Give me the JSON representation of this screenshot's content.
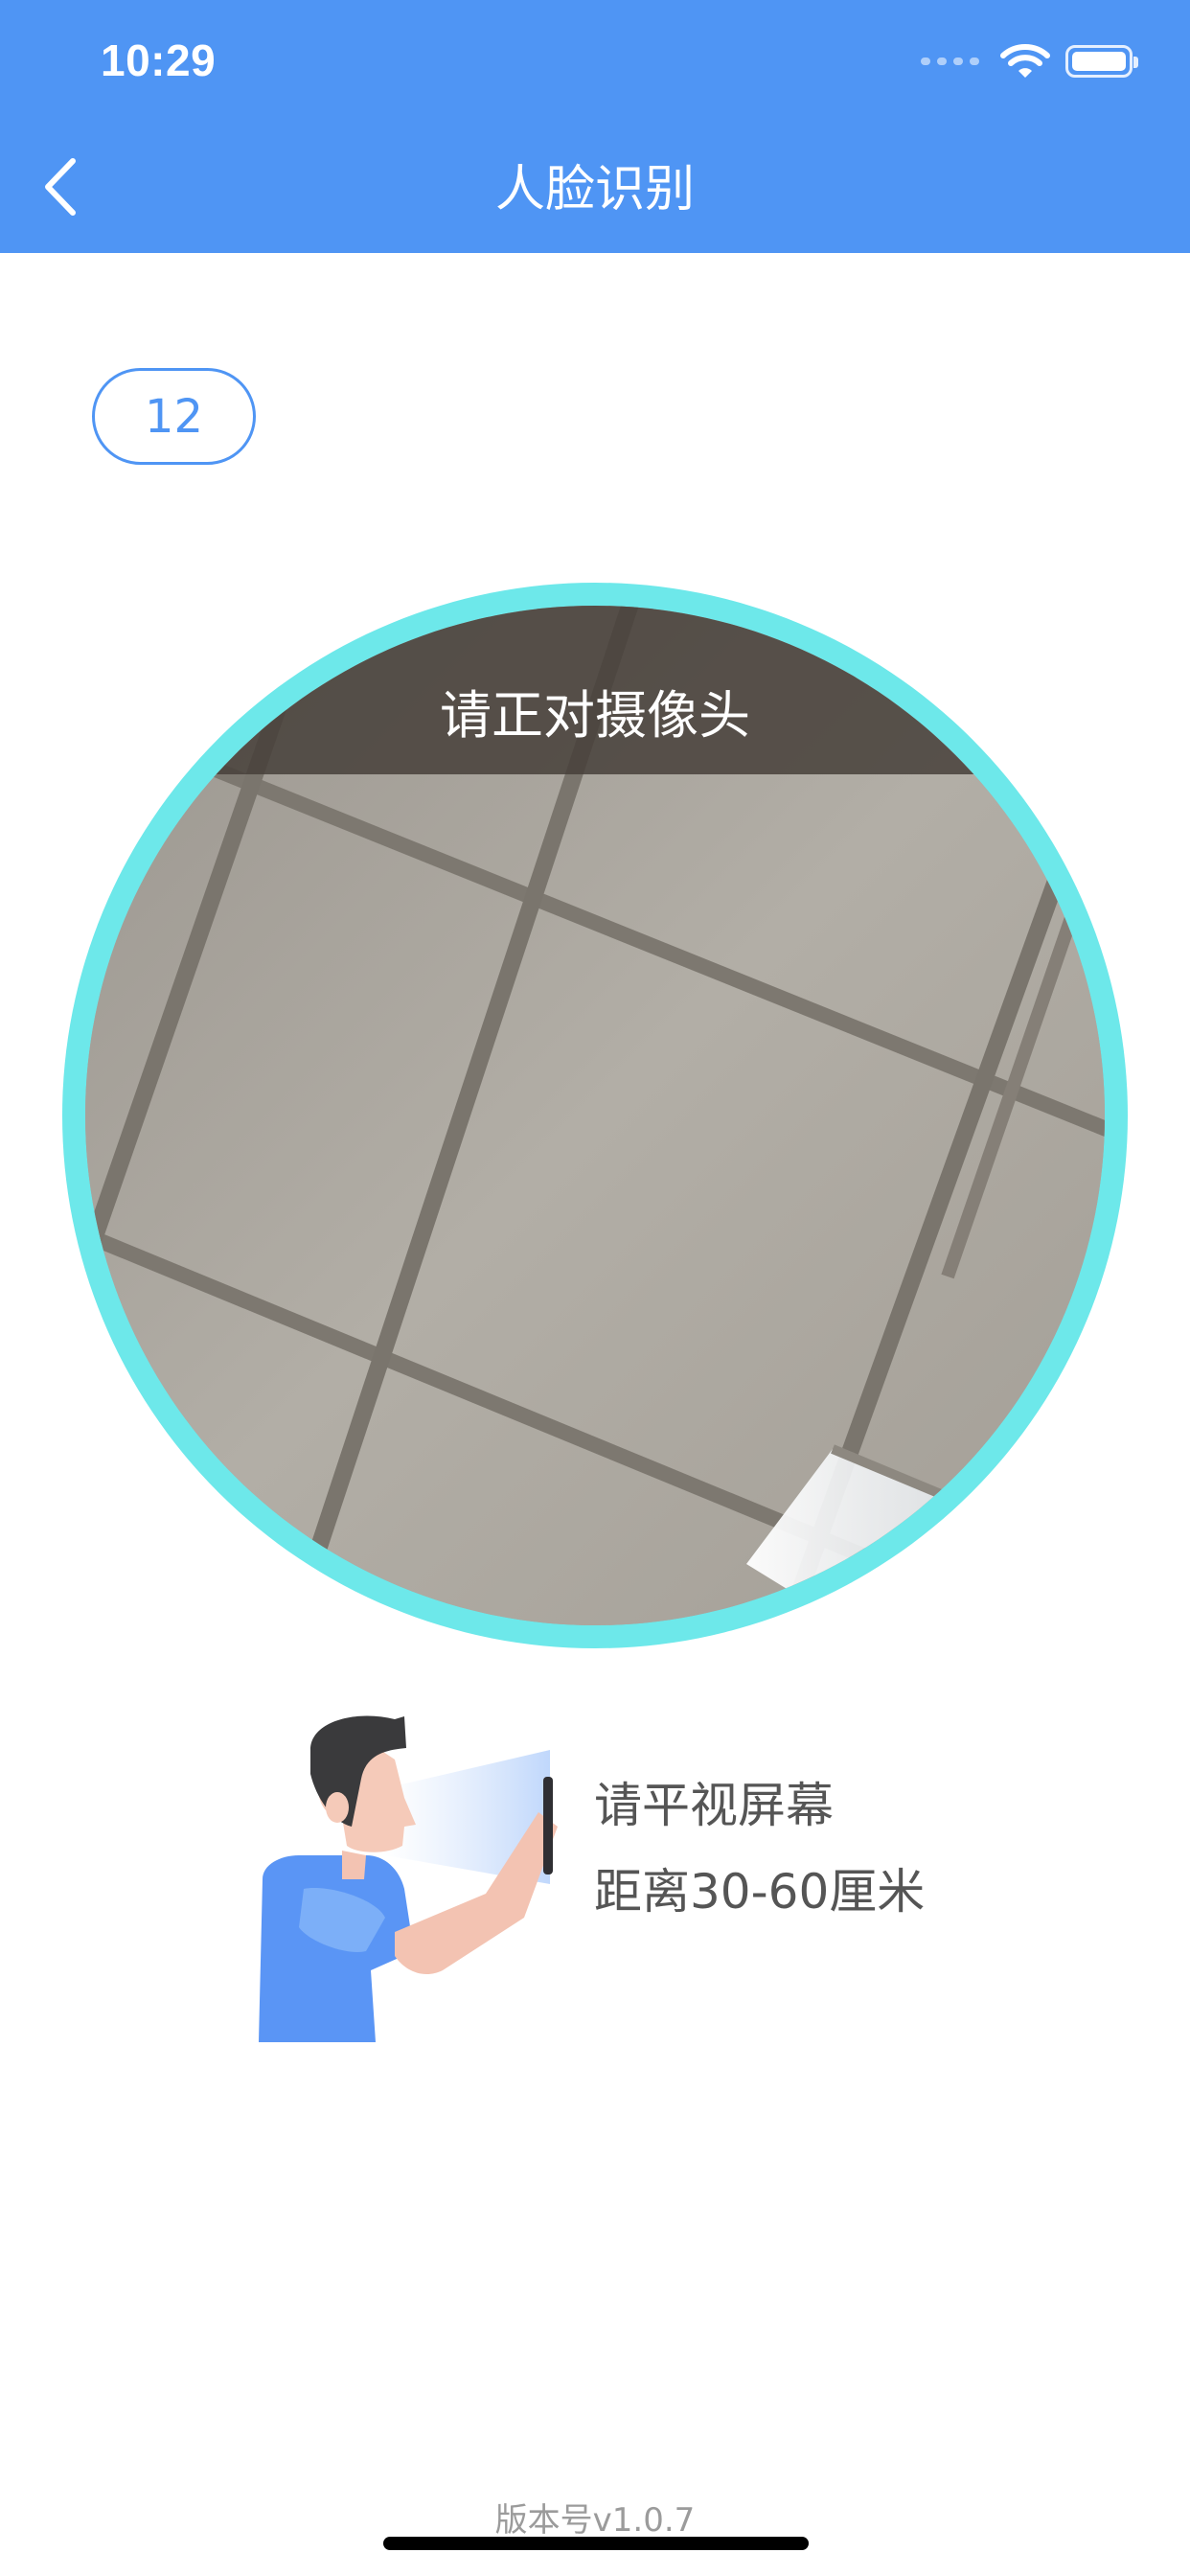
{
  "status_bar": {
    "time": "10:29"
  },
  "nav": {
    "title": "人脸识别"
  },
  "countdown": {
    "value": "12"
  },
  "camera": {
    "hint": "请正对摄像头"
  },
  "tips": {
    "line1": "请平视屏幕",
    "line2": "距离30-60厘米"
  },
  "footer": {
    "version": "版本号v1.0.7"
  },
  "colors": {
    "header": "#4f95f4",
    "accent": "#4f95f4",
    "ring": "#6de8ea",
    "tip_text": "#555555",
    "version_text": "#9b9b9b"
  },
  "icons": [
    "back-chevron-icon",
    "wifi-icon",
    "battery-icon",
    "signal-icon"
  ]
}
